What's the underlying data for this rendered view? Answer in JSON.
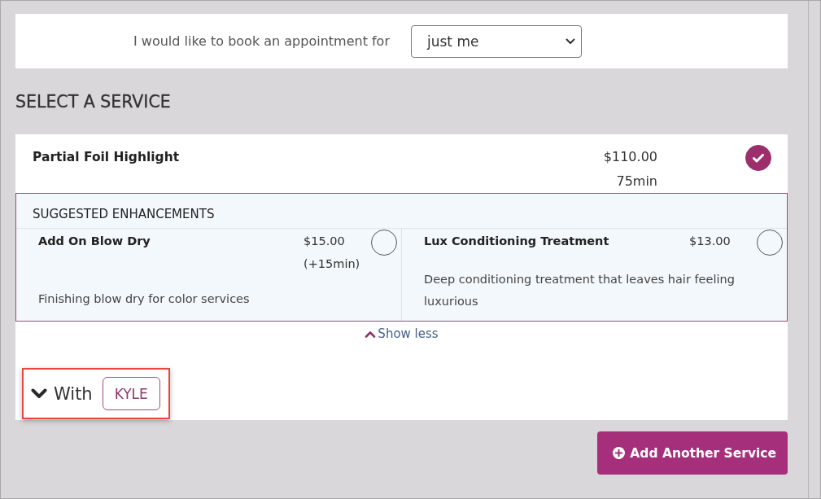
{
  "booking": {
    "label": "I would like to book an appointment for",
    "value": "just me"
  },
  "section_title": "SELECT A SERVICE",
  "services": [
    {
      "name": "Partial Foil Highlight",
      "price": "$110.00",
      "duration": "75min",
      "selected": true,
      "enhancements": {
        "title": "SUGGESTED ENHANCEMENTS",
        "items": [
          {
            "name": "Add On Blow Dry",
            "price": "$15.00",
            "duration": "(+15min)",
            "description": "Finishing blow dry for color services",
            "selected": false
          },
          {
            "name": "Lux Conditioning Treatment",
            "price": "$13.00",
            "description": "Deep conditioning treatment that leaves hair feeling luxurious",
            "selected": false
          }
        ]
      },
      "toggle_link": "Show less",
      "staff": {
        "label": "With",
        "name": "KYLE",
        "highlighted": true
      }
    }
  ],
  "add_button": "Add Another Service"
}
